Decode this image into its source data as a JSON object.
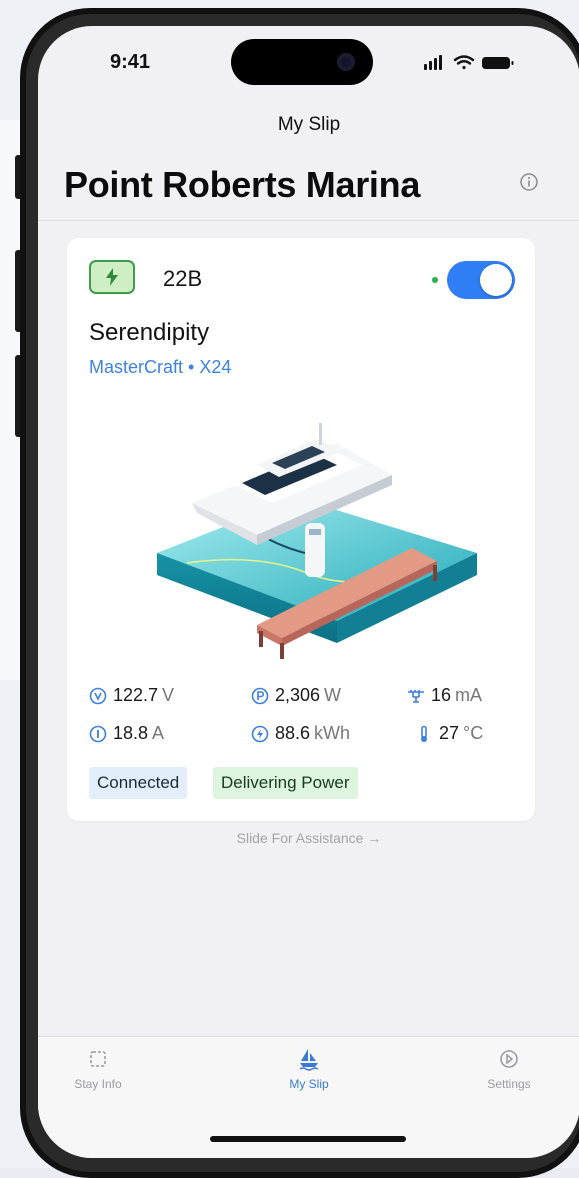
{
  "status_bar": {
    "time": "9:41"
  },
  "header": {
    "nav_title": "My Slip",
    "page_title": "Point Roberts Marina",
    "info_icon": "info-circle-icon"
  },
  "slip_card": {
    "slip_id": "22B",
    "badge_icon": "lightning-bolt-icon",
    "power_toggle_on": true,
    "boat_name": "Serendipity",
    "boat_model": "MasterCraft • X24",
    "illustration": "boat-at-dock-with-charging-pedestal",
    "metrics": [
      {
        "icon": "voltage-icon",
        "value": "122.7",
        "unit": "V"
      },
      {
        "icon": "power-icon",
        "value": "2,306",
        "unit": "W"
      },
      {
        "icon": "leakage-current-icon",
        "value": "16",
        "unit": "mA"
      },
      {
        "icon": "current-icon",
        "value": "18.8",
        "unit": "A"
      },
      {
        "icon": "energy-icon",
        "value": "88.6",
        "unit": "kWh"
      },
      {
        "icon": "thermometer-icon",
        "value": "27",
        "unit": "°C"
      }
    ],
    "tags": [
      "Connected",
      "Delivering Power"
    ]
  },
  "slide_hint": "Slide For Assistance →",
  "tabbar": {
    "tabs": [
      {
        "label": "Stay Info",
        "icon": "calendar-icon",
        "active": false
      },
      {
        "label": "My Slip",
        "icon": "boat-icon",
        "active": true
      },
      {
        "label": "Settings",
        "icon": "gauge-icon",
        "active": false
      }
    ]
  },
  "colors": {
    "accent_blue": "#2f7ef5",
    "badge_green": "#3e9b49",
    "connected_tag_bg": "#e2eef9",
    "power_tag_bg": "#ddf4df",
    "live_dot": "#26b34a"
  }
}
